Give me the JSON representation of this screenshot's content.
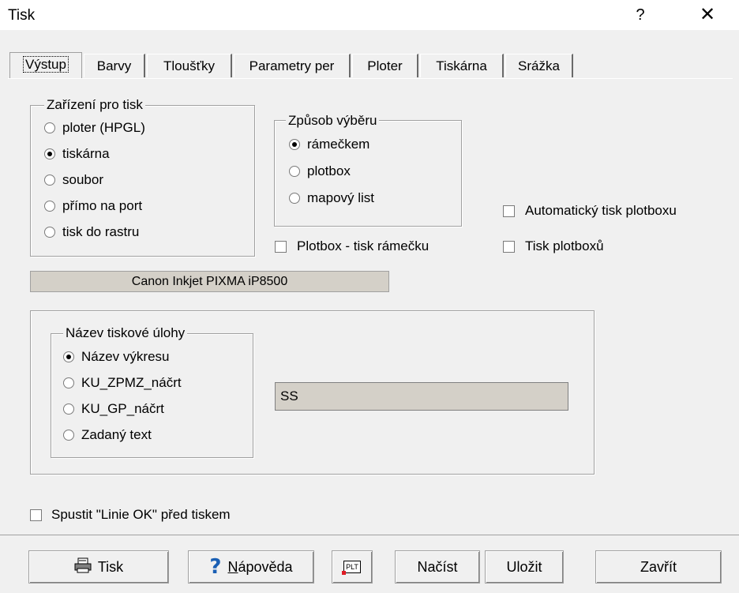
{
  "window": {
    "title": "Tisk",
    "help": "?",
    "close": "✕"
  },
  "tabs": [
    "Výstup",
    "Barvy",
    "Tloušťky",
    "Parametry per",
    "Ploter",
    "Tiskárna",
    "Srážka"
  ],
  "device_group": {
    "legend": "Zařízení pro tisk",
    "options": [
      "ploter (HPGL)",
      "tiskárna",
      "soubor",
      "přímo na port",
      "tisk do rastru"
    ],
    "selected_index": 1
  },
  "selection_group": {
    "legend": "Způsob výběru",
    "options": [
      "rámečkem",
      "plotbox",
      "mapový list"
    ],
    "selected_index": 0
  },
  "checkboxes": {
    "plotbox_frame": {
      "label": "Plotbox - tisk rámečku",
      "checked": false
    },
    "auto_plotbox": {
      "label": "Automatický tisk plotboxu",
      "checked": false
    },
    "plotbox_print": {
      "label": "Tisk plotboxů",
      "checked": false
    },
    "run_lines_ok": {
      "label": "Spustit \"Linie OK\" před tiskem",
      "checked": false
    }
  },
  "printer_name": "Canon Inkjet PIXMA iP8500",
  "job_group": {
    "legend": "Název tiskové úlohy",
    "options": [
      "Název výkresu",
      "KU_ZPMZ_náčrt",
      "KU_GP_náčrt",
      "Zadaný text"
    ],
    "selected_index": 0,
    "text_value": "SS"
  },
  "buttons": {
    "print": "Tisk",
    "help_prefix": "N",
    "help_rest": "ápověda",
    "plt_icon": "PLT",
    "load": "Načíst",
    "save": "Uložit",
    "close": "Zavřít"
  }
}
